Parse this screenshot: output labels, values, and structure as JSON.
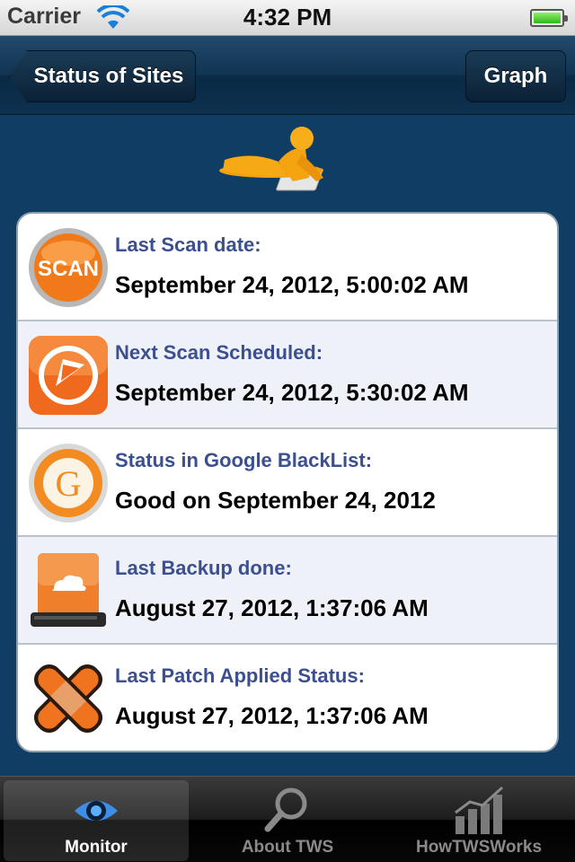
{
  "status_bar": {
    "carrier": "Carrier",
    "time": "4:32 PM"
  },
  "nav": {
    "back_label": "Status of Sites",
    "right_label": "Graph"
  },
  "items": [
    {
      "label": "Last Scan date:",
      "value": "September 24, 2012, 5:00:02 AM",
      "icon": "scan-icon",
      "icon_text": "SCAN"
    },
    {
      "label": "Next Scan Scheduled:",
      "value": "September 24, 2012, 5:30:02 AM",
      "icon": "schedule-icon"
    },
    {
      "label": "Status in Google BlackList:",
      "value": "Good on September 24, 2012",
      "icon": "google-icon",
      "icon_text": "G"
    },
    {
      "label": "Last Backup done:",
      "value": "August 27, 2012, 1:37:06 AM",
      "icon": "backup-drive-icon"
    },
    {
      "label": "Last Patch Applied Status:",
      "value": "August 27, 2012, 1:37:06 AM",
      "icon": "patch-bandage-icon"
    }
  ],
  "tabs": [
    {
      "label": "Monitor",
      "icon": "eye-icon",
      "selected": true
    },
    {
      "label": "About TWS",
      "icon": "magnifier-icon",
      "selected": false
    },
    {
      "label": "HowTWSWorks",
      "icon": "bar-chart-icon",
      "selected": false
    }
  ],
  "colors": {
    "background": "#0f3d63",
    "label": "#3c4f8f",
    "accent_orange": "#f07a1a"
  }
}
